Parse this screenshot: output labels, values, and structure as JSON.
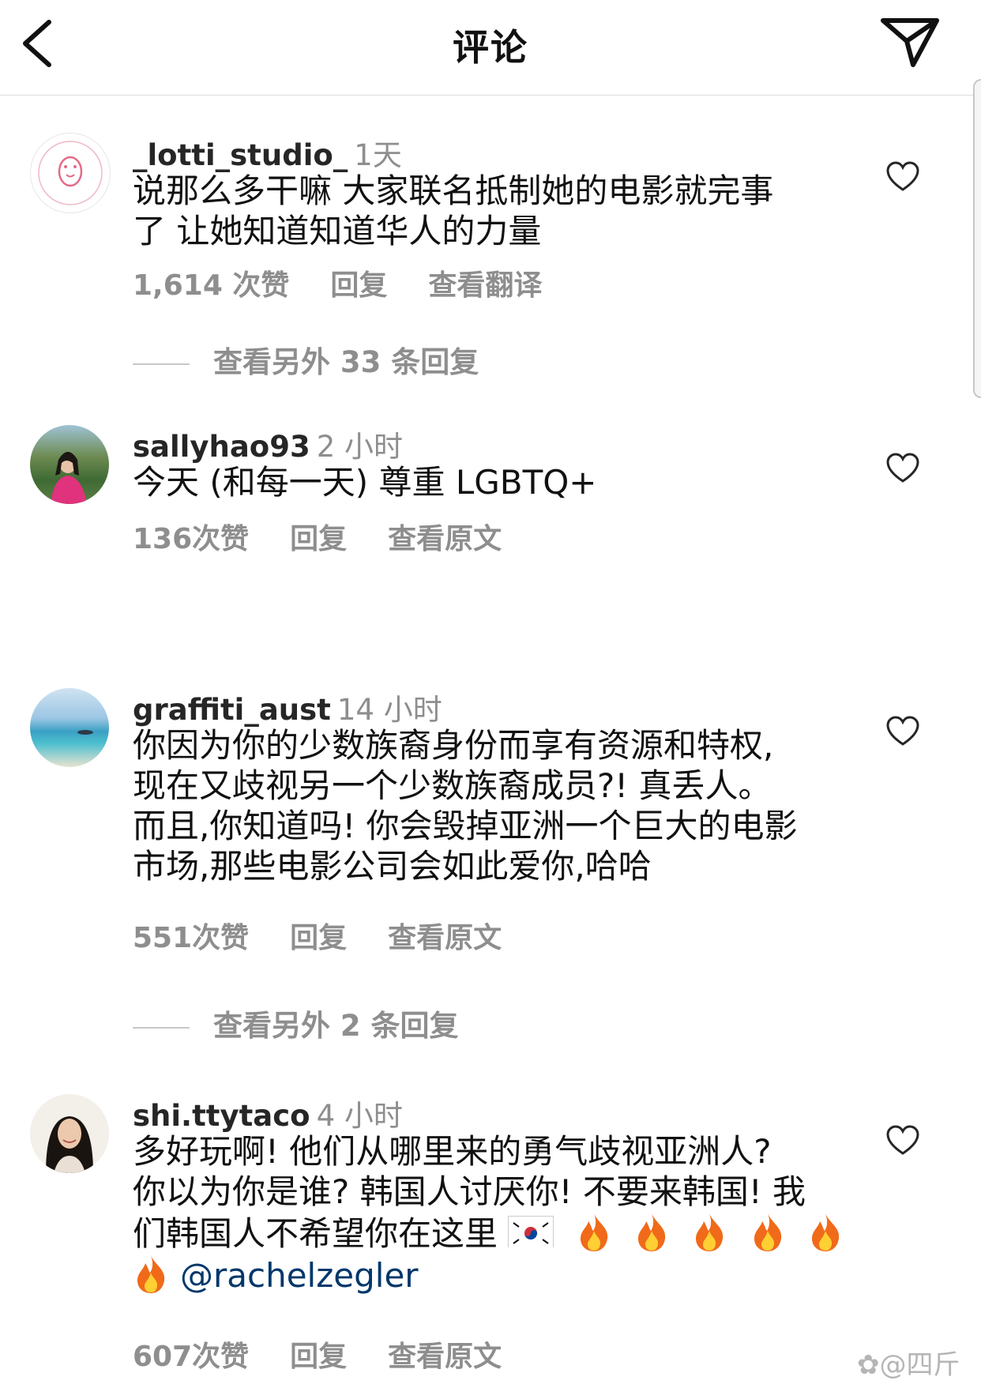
{
  "header": {
    "title": "评论"
  },
  "comments": [
    {
      "username": "_lotti_studio_",
      "time": "1天",
      "lines": [
        "说那么多干嘛 大家联名抵制她的电影就完事",
        "了 让她知道知道华人的力量"
      ],
      "likes": "1,614 次赞",
      "reply": "回复",
      "translate": "查看翻译"
    },
    {
      "username": "sallyhao93",
      "time": "2 小时",
      "lines": [
        "今天 (和每一天) 尊重 LGBTQ+"
      ],
      "likes": "136次赞",
      "reply": "回复",
      "translate": "查看原文"
    },
    {
      "username": "graffiti_aust",
      "time": "14 小时",
      "lines": [
        "你因为你的少数族裔身份而享有资源和特权,",
        "现在又歧视另一个少数族裔成员?! 真丢人。",
        "而且,你知道吗! 你会毁掉亚洲一个巨大的电影",
        "市场,那些电影公司会如此爱你,哈哈"
      ],
      "likes": "551次赞",
      "reply": "回复",
      "translate": "查看原文"
    },
    {
      "username": "shi.ttytaco",
      "time": "4 小时",
      "lines": [
        "多好玩啊! 他们从哪里来的勇气歧视亚洲人?",
        "你以为你是谁? 韩国人讨厌你! 不要来韩国! 我",
        "们韩国人不希望你在这里"
      ],
      "mention": "@rachelzegler",
      "likes": "607次赞",
      "reply": "回复",
      "translate": "查看原文"
    }
  ],
  "more_replies": [
    "查看另外 33 条回复",
    "查看另外 2 条回复"
  ],
  "watermark": "@四斤"
}
